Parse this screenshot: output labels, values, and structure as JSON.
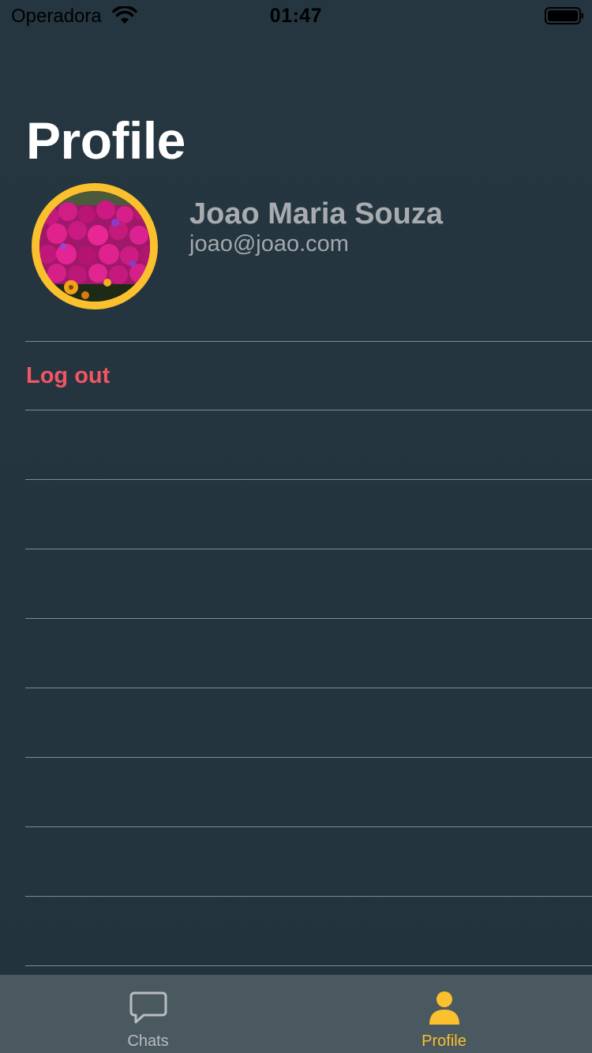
{
  "status_bar": {
    "carrier": "Operadora",
    "time": "01:47"
  },
  "page": {
    "title": "Profile"
  },
  "user": {
    "name": "Joao Maria Souza",
    "email": "joao@joao.com"
  },
  "actions": {
    "logout_label": "Log out"
  },
  "tab_bar": {
    "tabs": [
      {
        "label": "Chats",
        "icon": "chat-bubble-icon",
        "active": false
      },
      {
        "label": "Profile",
        "icon": "person-icon",
        "active": true
      }
    ]
  },
  "colors": {
    "background": "#253640",
    "accent": "#fbc02d",
    "danger": "#f25563",
    "tab_bar": "#4a5860",
    "separator": "#7f8a91"
  }
}
